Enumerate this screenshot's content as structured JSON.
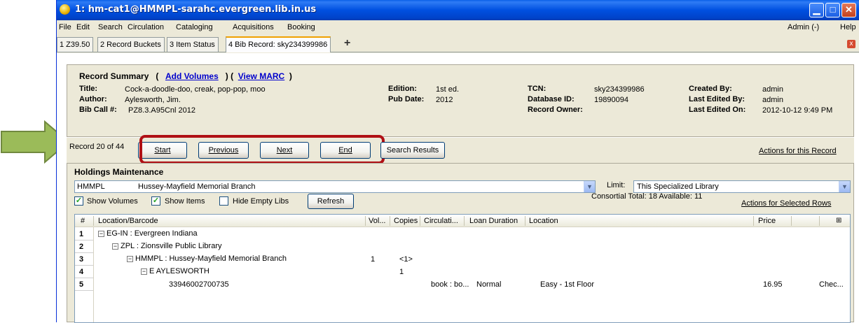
{
  "window": {
    "title": "1: hm-cat1@HMMPL-sarahc.evergreen.lib.in.us",
    "min_glyph": "▁",
    "max_glyph": "□",
    "close_glyph": "✕"
  },
  "menu": {
    "left": [
      "File",
      "Edit",
      "Search",
      "Circulation",
      "Cataloging",
      "Acquisitions",
      "Booking"
    ],
    "admin": "Admin (-)",
    "help": "Help"
  },
  "tabs": [
    {
      "label": "1 Z39.50"
    },
    {
      "label": "2 Record Buckets"
    },
    {
      "label": "3 Item Status"
    },
    {
      "label": "4 Bib Record: sky234399986"
    }
  ],
  "tab_add": "+",
  "tab_close": "x",
  "summary": {
    "header": "Record Summary",
    "open_paren": "(",
    "add_volumes": "Add Volumes",
    "mid_paren": ") (",
    "view_marc": "View MARC",
    "close_paren": ")",
    "title_label": "Title:",
    "title_value": "Cock-a-doodle-doo, creak, pop-pop, moo",
    "author_label": "Author:",
    "author_value": "Aylesworth, Jim.",
    "call_label": "Bib Call #:",
    "call_value": "PZ8.3.A95Cnl 2012",
    "edition_label": "Edition:",
    "edition_value": "1st ed.",
    "pubdate_label": "Pub Date:",
    "pubdate_value": "2012",
    "tcn_label": "TCN:",
    "tcn_value": "sky234399986",
    "dbid_label": "Database ID:",
    "dbid_value": "19890094",
    "owner_label": "Record Owner:",
    "created_label": "Created By:",
    "created_value": "admin",
    "edited_by_label": "Last Edited By:",
    "edited_by_value": "admin",
    "edited_on_label": "Last Edited On:",
    "edited_on_value": "2012-10-12 9:49 PM"
  },
  "nav": {
    "record_position": "Record 20 of 44",
    "start": "Start",
    "previous": "Previous",
    "next": "Next",
    "end": "End",
    "search_results": "Search Results",
    "actions_record": "Actions for this Record"
  },
  "holdings": {
    "title": "Holdings Maintenance",
    "lib_code": "HMMPL",
    "lib_name": "Hussey-Mayfield Memorial Branch",
    "limit_label": "Limit:",
    "limit_value": "This Specialized Library",
    "show_volumes": "Show Volumes",
    "show_items": "Show Items",
    "hide_empty": "Hide Empty Libs",
    "refresh": "Refresh",
    "consortial": "Consortial Total:  18  Available:  11",
    "actions_selected": "Actions for Selected Rows",
    "columns": [
      "#",
      "Location/Barcode",
      "Vol...",
      "Copies",
      "Circulati...",
      "Loan Duration",
      "Location",
      "Price"
    ],
    "rows": [
      {
        "num": "1",
        "label": "EG-IN : Evergreen Indiana"
      },
      {
        "num": "2",
        "label": "ZPL : Zionsville Public Library"
      },
      {
        "num": "3",
        "label": "HMMPL : Hussey-Mayfield Memorial Branch",
        "vol": "1",
        "copies": "<1>"
      },
      {
        "num": "4",
        "label": "E AYLESWORTH",
        "copies": "1"
      },
      {
        "num": "5",
        "label": "33946002700735",
        "circ": "book : bo...",
        "loan": "Normal",
        "location": "Easy - 1st Floor",
        "price": "16.95",
        "status": "Chec..."
      }
    ],
    "tree_toggle": "−",
    "column_picker_icon": "column-picker"
  },
  "colors": {
    "arrow": "#9bbb59",
    "highlight": "#b01015",
    "title_bar": "#0050e0",
    "link": "#0000cc"
  }
}
